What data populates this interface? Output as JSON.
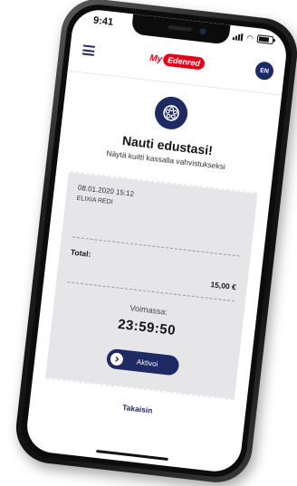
{
  "status": {
    "time": "9:41"
  },
  "header": {
    "logo_prefix": "My",
    "logo_brand": "Edenred",
    "language": "EN"
  },
  "hero": {
    "title": "Nauti edustasi!",
    "subtitle": "Näytä kuitti kassalla vahvistukseksi"
  },
  "receipt": {
    "datetime": "08.01.2020 15:12",
    "merchant": "ELIXIA REDI",
    "total_label": "Total:",
    "total_value": "15,00 €",
    "valid_label": "Voimassa:",
    "countdown": "23:59:50",
    "activate_label": "Aktivoi"
  },
  "footer": {
    "back_label": "Takaisin"
  },
  "colors": {
    "primary": "#1d2a63",
    "brand_red": "#e2001a",
    "ticket_bg": "#e6e6e8"
  },
  "icons": {
    "menu": "hamburger-icon",
    "badge": "film-reel-icon",
    "activate": "chevron-right-icon"
  }
}
